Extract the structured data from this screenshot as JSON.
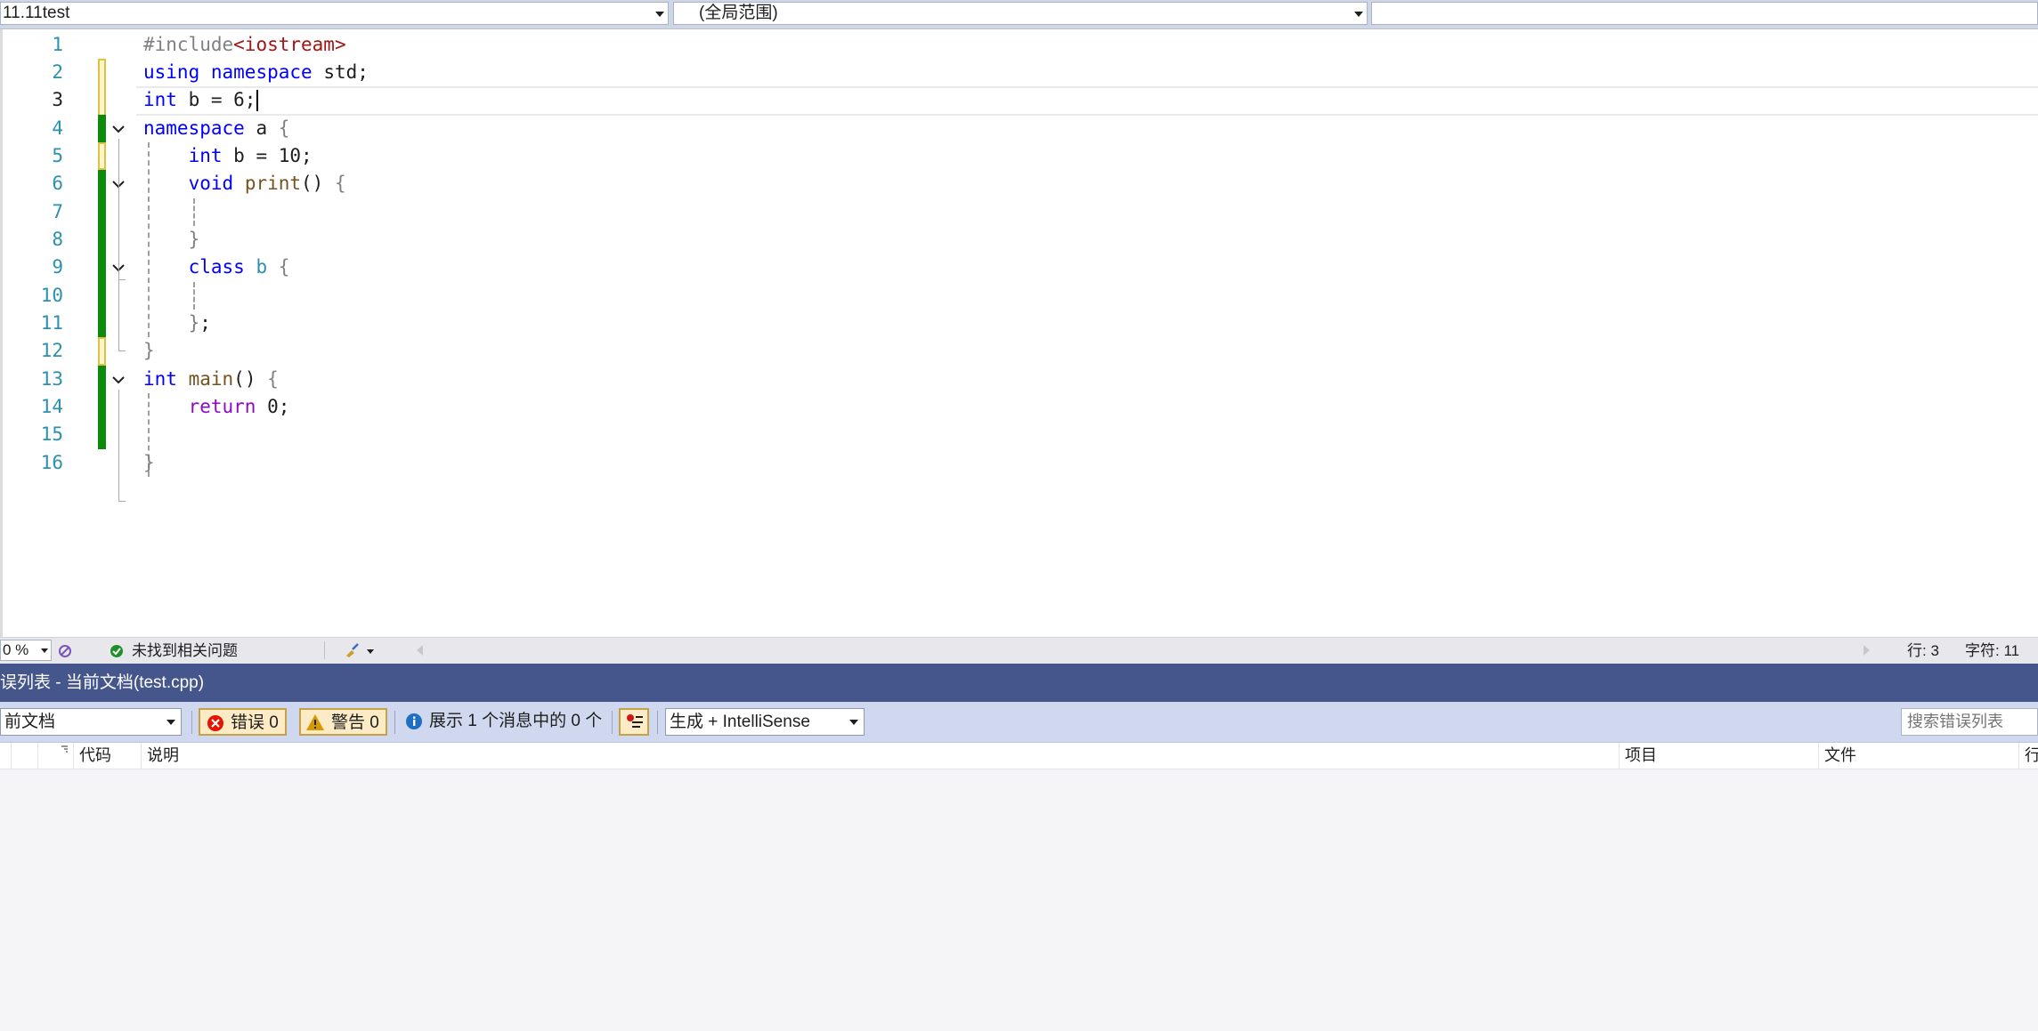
{
  "navbar": {
    "project": "11.11test",
    "scope": "(全局范围)",
    "member": ""
  },
  "editor": {
    "line_numbers": [
      "1",
      "2",
      "3",
      "4",
      "5",
      "6",
      "7",
      "8",
      "9",
      "10",
      "11",
      "12",
      "13",
      "14",
      "15",
      "16"
    ],
    "current_line": 3,
    "code_lines": [
      "#include<iostream>",
      "using namespace std;",
      "int b = 6;",
      "namespace a {",
      "    int b = 10;",
      "    void print() {",
      "",
      "    }",
      "    class b {",
      "",
      "    };",
      "}",
      "int main() {",
      "    return 0;",
      "",
      "}"
    ]
  },
  "status": {
    "zoom": "0 %",
    "issues": "未找到相关问题",
    "line": "行: 3",
    "char": "字符: 11"
  },
  "error_list": {
    "title": "误列表 - 当前文档(test.cpp)",
    "scope": "前文档",
    "errors": "错误 0",
    "warnings": "警告 0",
    "messages": "展示 1 个消息中的 0 个",
    "source": "生成 + IntelliSense",
    "search_placeholder": "搜索错误列表",
    "columns": [
      "代码",
      "说明",
      "项目",
      "文件",
      "行"
    ]
  },
  "colors": {
    "keyword": "#0000ff",
    "type": "#2b91af",
    "function": "#74531f",
    "saved_change": "#0c8a0c",
    "panel_title": "#44568c"
  }
}
